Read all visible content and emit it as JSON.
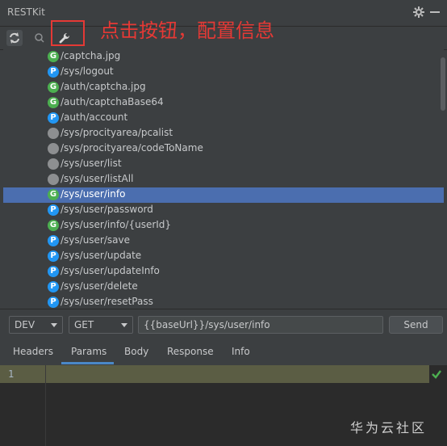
{
  "window": {
    "title": "RESTKit"
  },
  "annotation": {
    "text": "点击按钮，配置信息"
  },
  "colors": {
    "selected": "#4b6eaf",
    "get_badge": "#4caf50",
    "post_badge": "#2196f3",
    "other_badge": "#8d8f91",
    "annotation": "#e53935"
  },
  "endpoints": [
    {
      "method": "G",
      "path": "/captcha.jpg"
    },
    {
      "method": "P",
      "path": "/sys/logout"
    },
    {
      "method": "G",
      "path": "/auth/captcha.jpg"
    },
    {
      "method": "G",
      "path": "/auth/captchaBase64"
    },
    {
      "method": "P",
      "path": "/auth/account"
    },
    {
      "method": "",
      "path": "/sys/procityarea/pcalist"
    },
    {
      "method": "",
      "path": "/sys/procityarea/codeToName"
    },
    {
      "method": "",
      "path": "/sys/user/list"
    },
    {
      "method": "",
      "path": "/sys/user/listAll"
    },
    {
      "method": "G",
      "path": "/sys/user/info"
    },
    {
      "method": "P",
      "path": "/sys/user/password"
    },
    {
      "method": "G",
      "path": "/sys/user/info/{userId}"
    },
    {
      "method": "P",
      "path": "/sys/user/save"
    },
    {
      "method": "P",
      "path": "/sys/user/update"
    },
    {
      "method": "P",
      "path": "/sys/user/updateInfo"
    },
    {
      "method": "P",
      "path": "/sys/user/delete"
    },
    {
      "method": "P",
      "path": "/sys/user/resetPass"
    }
  ],
  "selected_index": 9,
  "request": {
    "env": "DEV",
    "method": "GET",
    "url": "{{baseUrl}}/sys/user/info",
    "send_label": "Send"
  },
  "tabs": [
    {
      "label": "Headers"
    },
    {
      "label": "Params"
    },
    {
      "label": "Body"
    },
    {
      "label": "Response"
    },
    {
      "label": "Info"
    }
  ],
  "active_tab": 1,
  "editor": {
    "line_number": "1"
  },
  "watermark": "华为云社区"
}
